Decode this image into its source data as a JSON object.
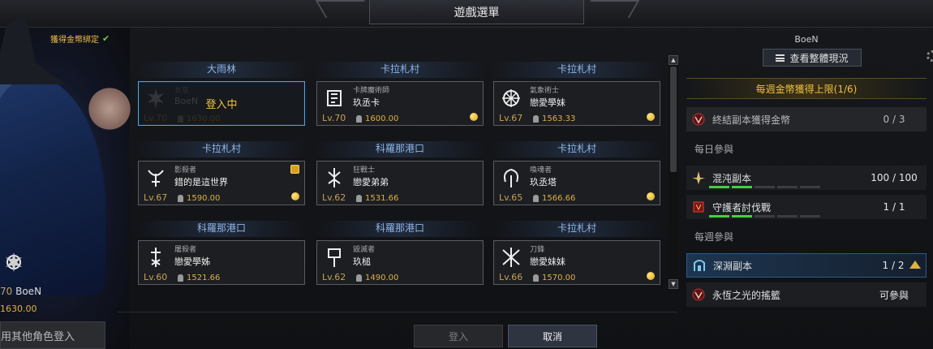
{
  "window": {
    "title": "遊戲選單"
  },
  "character": {
    "gold_bind_label": "獲得金幣綁定",
    "level": "70",
    "name": "BoeN",
    "item_level": "1630.00",
    "other_login_label": "用其他角色登入"
  },
  "slots": [
    {
      "location": "大雨林",
      "class": "女巫",
      "name": "BoeN",
      "level": "Lv.70",
      "item_level": "1630.00",
      "status": "登入中",
      "icon": "witch-icon",
      "coin": false,
      "gift": false
    },
    {
      "location": "卡拉札村",
      "class": "卡牌魔術師",
      "name": "玖丞卡",
      "level": "Lv.70",
      "item_level": "1600.00",
      "icon": "card-master-icon",
      "coin": true,
      "gift": false
    },
    {
      "location": "卡拉札村",
      "class": "氣象術士",
      "name": "戀愛學妹",
      "level": "Lv.67",
      "item_level": "1563.33",
      "icon": "aeromancer-icon",
      "coin": true,
      "gift": false
    },
    {
      "location": "卡拉札村",
      "class": "影殺者",
      "name": "錯的是這世界",
      "level": "Lv.67",
      "item_level": "1590.00",
      "icon": "shadowhunter-icon",
      "coin": true,
      "gift": true
    },
    {
      "location": "科羅那港口",
      "class": "狂戰士",
      "name": "戀愛弟弟",
      "level": "Lv.62",
      "item_level": "1531.66",
      "icon": "berserker-icon",
      "coin": false,
      "gift": false
    },
    {
      "location": "卡拉札村",
      "class": "喚魂者",
      "name": "玖丞塔",
      "level": "Lv.65",
      "item_level": "1566.66",
      "icon": "soul-eater-icon",
      "coin": true,
      "gift": false
    },
    {
      "location": "科羅那港口",
      "class": "屠殺者",
      "name": "戀愛學姊",
      "level": "Lv.60",
      "item_level": "1521.66",
      "icon": "slayer-icon",
      "coin": false,
      "gift": false
    },
    {
      "location": "科羅那港口",
      "class": "毀滅者",
      "name": "玖槌",
      "level": "Lv.62",
      "item_level": "1490.00",
      "icon": "destroyer-icon",
      "coin": false,
      "gift": false
    },
    {
      "location": "卡拉札村",
      "class": "刀鋒",
      "name": "戀愛妹妹",
      "level": "Lv.66",
      "item_level": "1570.00",
      "icon": "deathblade-icon",
      "coin": true,
      "gift": false
    }
  ],
  "right_panel": {
    "user": "BoeN",
    "view_all_label": "查看整體現況",
    "weekly_gold_header": "每週金幣獲得上限(1/6)",
    "gold_raid": {
      "label": "終結副本獲得金幣",
      "value": "0 / 3"
    },
    "daily_section": "每日參與",
    "chaos": {
      "label": "混沌副本",
      "value": "100 / 100",
      "pips_filled": 2,
      "pips_total": 5
    },
    "guardian": {
      "label": "守護者討伐戰",
      "value": "1 / 1",
      "pips_filled": 2,
      "pips_total": 5
    },
    "weekly_section": "每週參與",
    "abyss": {
      "label": "深淵副本",
      "value": "1 / 2"
    },
    "cradle": {
      "label": "永恆之光的搖籃",
      "value": "可參與"
    }
  },
  "buttons": {
    "login": "登入",
    "cancel": "取消"
  },
  "colors": {
    "accent_gold": "#f0c040",
    "location_blue": "#8fb6e8",
    "active_border": "#4aa3e8",
    "pip_green": "#44d040"
  }
}
